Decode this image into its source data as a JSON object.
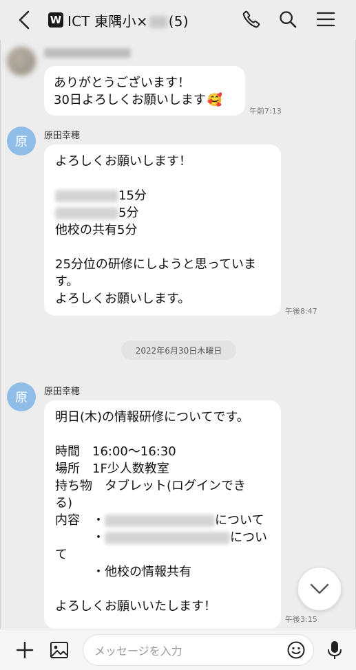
{
  "header": {
    "badge": "W",
    "title": "ICT 東隅小×",
    "member_count": "(5)"
  },
  "messages": [
    {
      "lines": [
        "ありがとうございます！",
        "30日よろしくお願いします"
      ],
      "emoji": "🥰",
      "time": "午前7:13"
    },
    {
      "avatar": "原",
      "sender": "原田幸穂",
      "lines": [
        "よろしくお願いします！",
        "",
        "15分",
        "5分",
        "他校の共有5分",
        "",
        "25分位の研修にしようと思っていま",
        "す。",
        "よろしくお願いします。"
      ],
      "time": "午後8:47"
    },
    {
      "avatar": "原",
      "sender": "原田幸穂",
      "lines": [
        "明日(木)の情報研修についてです。",
        "",
        "時間　16:00〜16:30",
        "場所　1F少人数教室",
        "持ち物　タブレット(ログインでき",
        "る)",
        "内容　・",
        "について",
        "・",
        "につい",
        "て",
        "・他校の情報共有",
        "",
        "よろしくお願いいたします！"
      ],
      "time": "午後3:15"
    }
  ],
  "date_separator": "2022年6月30日木曜日",
  "composer": {
    "placeholder": "メッセージを入力"
  },
  "icons": {
    "back": "chevron-left-icon",
    "phone": "phone-icon",
    "search": "search-icon",
    "menu": "menu-icon",
    "scroll_down": "chevron-down-icon",
    "plus": "plus-icon",
    "image": "image-icon",
    "emoji": "smiley-icon",
    "mic": "microphone-icon"
  },
  "colors": {
    "background": "#ededed",
    "bubble": "#ffffff",
    "avatar": "#8fbde8"
  }
}
